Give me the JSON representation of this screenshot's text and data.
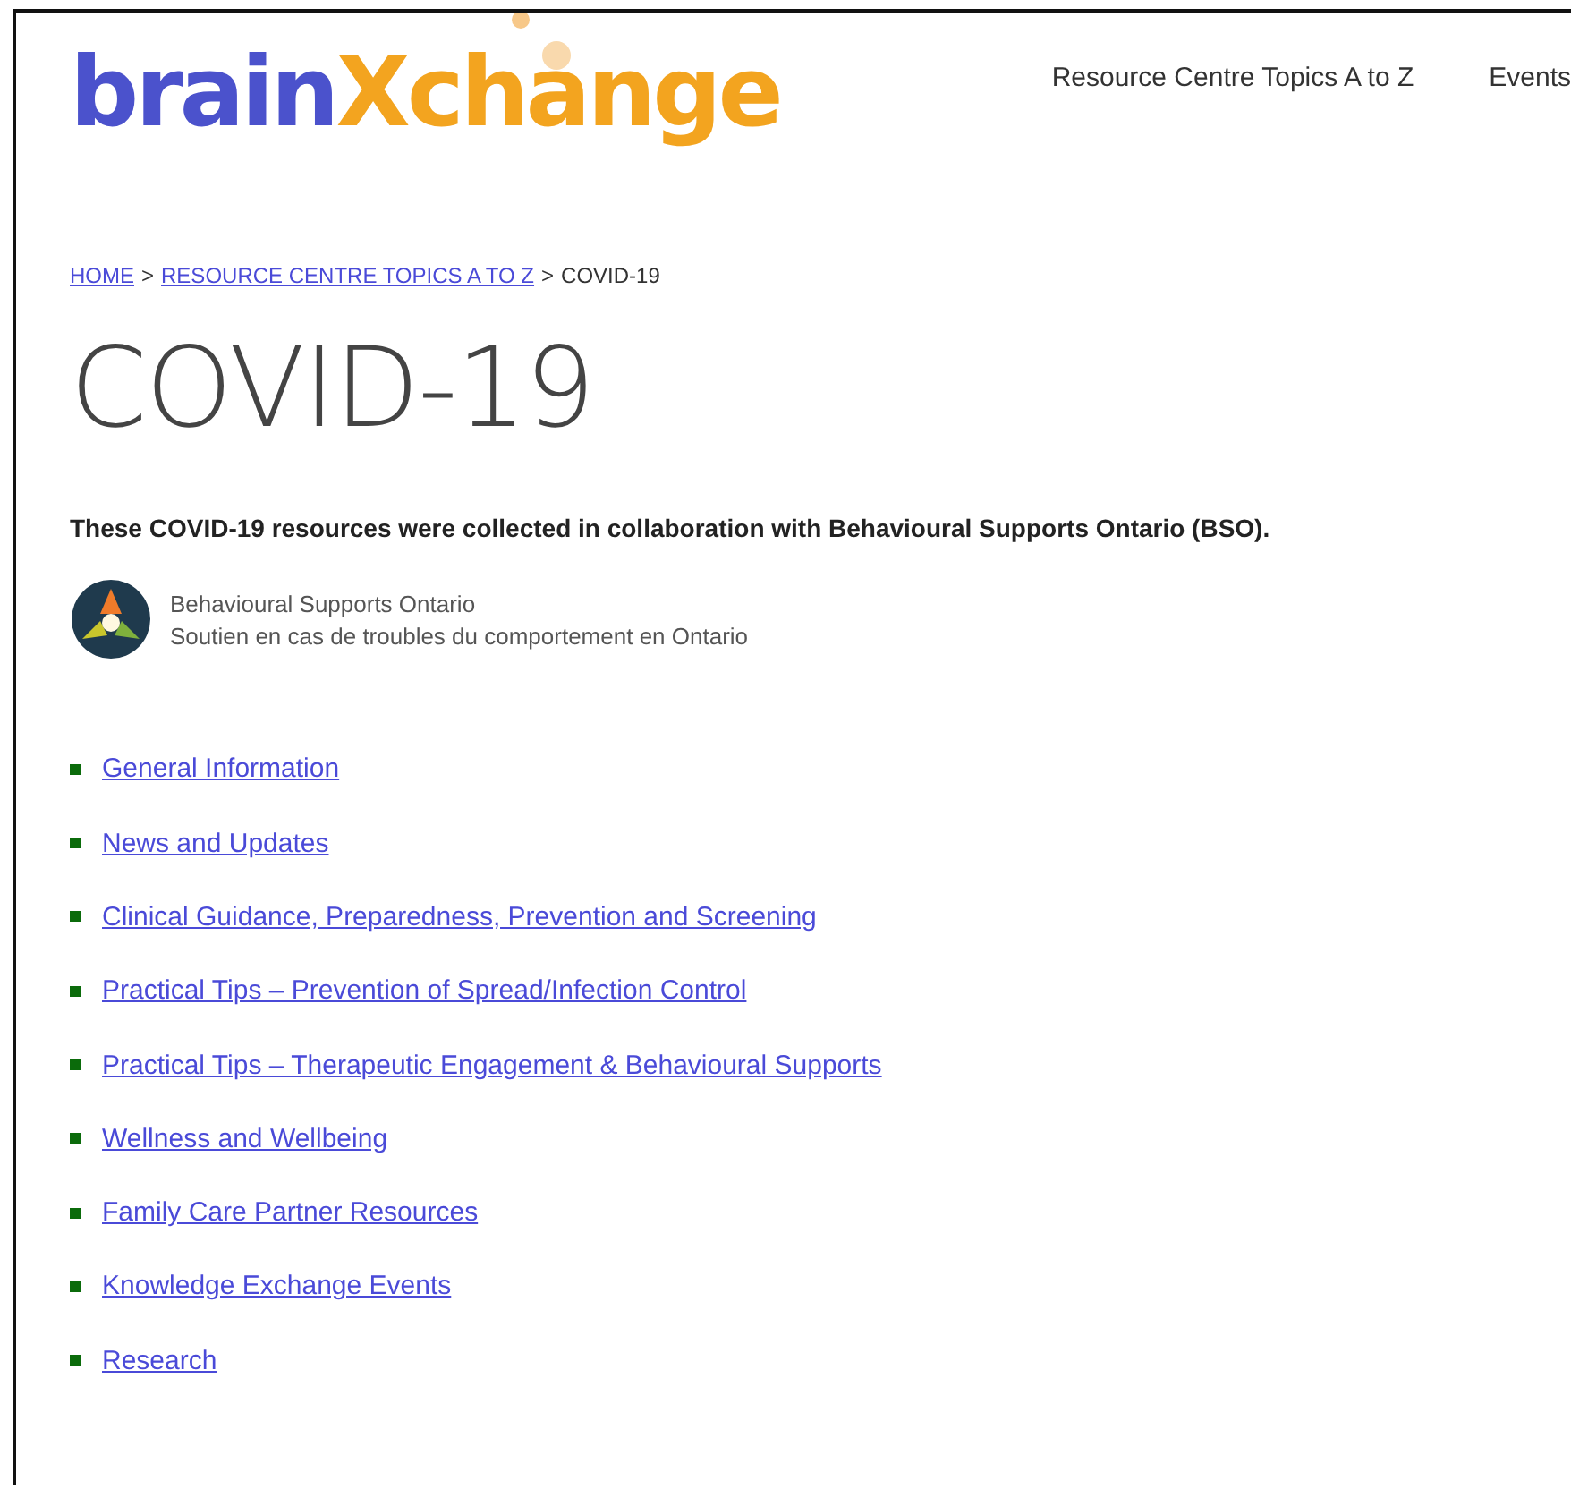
{
  "logo": {
    "parts": [
      {
        "text": "brain",
        "color": "#4b52cc"
      },
      {
        "text": "Xchange",
        "color": "#f3a41f"
      }
    ]
  },
  "nav": [
    "Resource Centre Topics A to Z",
    "Events"
  ],
  "breadcrumb": [
    {
      "label": "HOME",
      "link": true
    },
    {
      "label": "RESOURCE CENTRE TOPICS A TO Z",
      "link": true
    },
    {
      "label": "COVID-19",
      "link": false
    }
  ],
  "breadcrumb_separator": ">",
  "title": "COVID-19",
  "intro": "These COVID-19 resources were collected in collaboration with Behavioural Supports Ontario (BSO).",
  "partner": {
    "name": "Behavioural Supports Ontario",
    "tagline": "Soutien en cas de troubles du comportement en Ontario"
  },
  "links": [
    "General Information",
    "News and Updates",
    "Clinical Guidance, Preparedness, Prevention and Screening",
    "Practical Tips – Prevention of Spread/Infection Control",
    "Practical Tips – Therapeutic Engagement & Behavioural Supports",
    "Wellness and Wellbeing",
    "Family Care Partner Resources",
    "Knowledge Exchange Events",
    "Research"
  ]
}
